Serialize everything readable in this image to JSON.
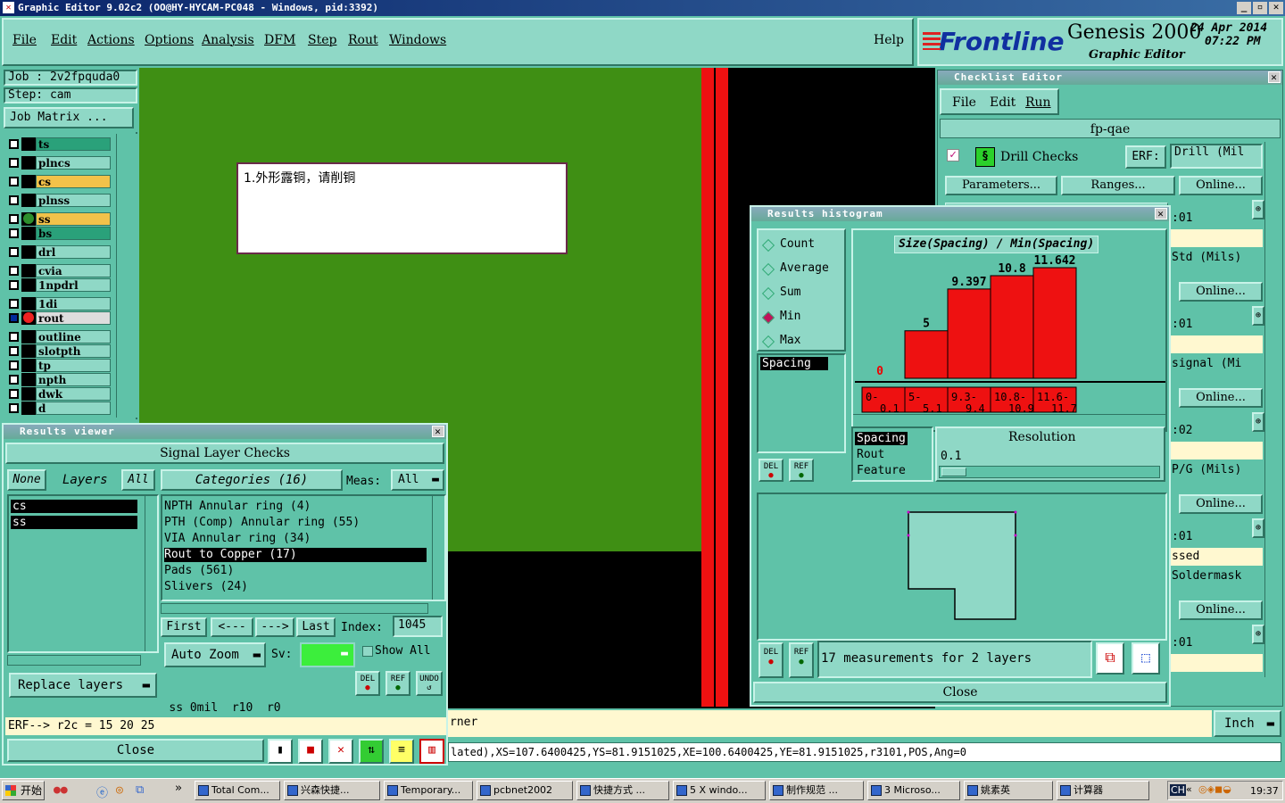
{
  "window": {
    "title": "Graphic Editor 9.02c2 (OO@HY-HYCAM-PC048 - Windows, pid:3392)"
  },
  "menu": [
    "File",
    "Edit",
    "Actions",
    "Options",
    "Analysis",
    "DFM",
    "Step",
    "Rout",
    "Windows"
  ],
  "help": "Help",
  "brand": {
    "logo": "Frontline",
    "product": "Genesis 2000",
    "date": "24 Apr 2014",
    "time": "07:22 PM",
    "subtitle": "Graphic Editor"
  },
  "job": {
    "job_label": "Job : 2v2fpquda0",
    "step_label": "Step: cam",
    "matrix_button": "Job Matrix ..."
  },
  "layers": [
    {
      "name": "ts",
      "color": "#2aa17a"
    },
    {
      "name": "plncs",
      "color": "#8fd8c6"
    },
    {
      "name": "cs",
      "color": "#f2c24a"
    },
    {
      "name": "plnss",
      "color": "#8fd8c6"
    },
    {
      "name": "ss",
      "color": "#f2c24a"
    },
    {
      "name": "bs",
      "color": "#2aa17a"
    },
    {
      "name": "drl",
      "color": "#8fd8c6"
    },
    {
      "name": "cvia",
      "color": "#8fd8c6"
    },
    {
      "name": "1npdrl",
      "color": "#8fd8c6"
    },
    {
      "name": "1di",
      "color": "#8fd8c6"
    },
    {
      "name": "rout",
      "color": "#dddddd"
    },
    {
      "name": "outline",
      "color": "#8fd8c6"
    },
    {
      "name": "slotpth",
      "color": "#8fd8c6"
    },
    {
      "name": "tp",
      "color": "#8fd8c6"
    },
    {
      "name": "npth",
      "color": "#8fd8c6"
    },
    {
      "name": "dwk",
      "color": "#8fd8c6"
    },
    {
      "name": "d",
      "color": "#8fd8c6"
    }
  ],
  "note": "1.外形露铜，请削铜",
  "checklist": {
    "title": "Checklist Editor",
    "menu": [
      "File",
      "Edit",
      "Run"
    ],
    "name": "fp-qae",
    "check_label": "Drill Checks",
    "erf_label": "ERF:",
    "erf_value": "Drill (Mil",
    "params_btn": "Parameters...",
    "ranges_btn": "Ranges...",
    "online_btn": "Online...",
    "items": [
      {
        "time": ":01",
        "model": "Std (Mils)"
      },
      {
        "time": ":01",
        "model": "signal (Mi"
      },
      {
        "time": ":02",
        "model": "P/G (Mils)"
      },
      {
        "time": ":01",
        "model": "Soldermask"
      },
      {
        "time": ":01",
        "model": ""
      }
    ],
    "status_partial": "ssed"
  },
  "histogram": {
    "title": "Results histogram",
    "radio_options": [
      "Count",
      "Average",
      "Sum",
      "Min",
      "Max"
    ],
    "selected": "Min",
    "chart_title": "Size(Spacing) / Min(Spacing)",
    "list_items": [
      "Spacing"
    ],
    "del": "DEL",
    "ref": "REF",
    "type_items": [
      "Spacing",
      "Rout",
      "Feature"
    ],
    "resolution_label": "Resolution",
    "resolution_value": "0.1",
    "measure_text": "17 measurements for 2 layers",
    "close": "Close"
  },
  "chart_data": {
    "type": "bar",
    "title": "Size(Spacing) / Min(Spacing)",
    "categories": [
      "0-0.1",
      "5-5.1",
      "9.3-9.4",
      "10.8-10.9",
      "11.6-11.7"
    ],
    "values": [
      0,
      5,
      9.397,
      10.8,
      11.642
    ],
    "value_labels": [
      "0",
      "5",
      "9.397",
      "10.8",
      "11.642"
    ],
    "category_top": [
      "0-",
      "5-",
      "9.3-",
      "10.8-",
      "11.6-"
    ],
    "category_bottom": [
      "0.1",
      "5.1",
      "9.4",
      "10.9",
      "11.7"
    ],
    "ylim": [
      0,
      11.642
    ],
    "bar_color": "#ee1111"
  },
  "results": {
    "title": "Results viewer",
    "header": "Signal Layer Checks",
    "none_btn": "None",
    "layers_label": "Layers",
    "all_btn": "All",
    "categories_label": "Categories (16)",
    "meas_label": "Meas:",
    "meas_value": "All",
    "layer_list": [
      "cs",
      "ss"
    ],
    "categories": [
      "NPTH Annular ring (4)",
      "PTH (Comp) Annular ring (55)",
      "VIA Annular ring (34)",
      "Rout to Copper (17)",
      "Pads (561)",
      "Slivers (24)"
    ],
    "selected_category": "Rout to Copper (17)",
    "first": "First",
    "prev": "<---",
    "next": "--->",
    "last": "Last",
    "index_label": "Index:",
    "index_value": "1045",
    "auto_zoom": "Auto Zoom",
    "sv_label": "Sv:",
    "show_all": "Show All",
    "replace_layers": "Replace layers",
    "del": "DEL",
    "ref": "REF",
    "undo": "UNDO",
    "status": "ss 0mil  r10  r0",
    "erf_line": "ERF--> r2c = 15 20 25",
    "close": "Close"
  },
  "bottom": {
    "msg": "rner",
    "coords": "lated),XS=107.6400425,YS=81.9151025,XE=100.6400425,YE=81.9151025,r3101,POS,Ang=0",
    "units": "Inch"
  },
  "taskbar": {
    "start": "开始",
    "items": [
      "Total Com...",
      "兴森快捷...",
      "Temporary...",
      "pcbnet2002",
      "快捷方式 ...",
      "5 X windo...",
      "制作规范 ...",
      "3 Microso...",
      "姚素英",
      "计算器"
    ],
    "tray_label": "CH",
    "clock": "19:37"
  }
}
